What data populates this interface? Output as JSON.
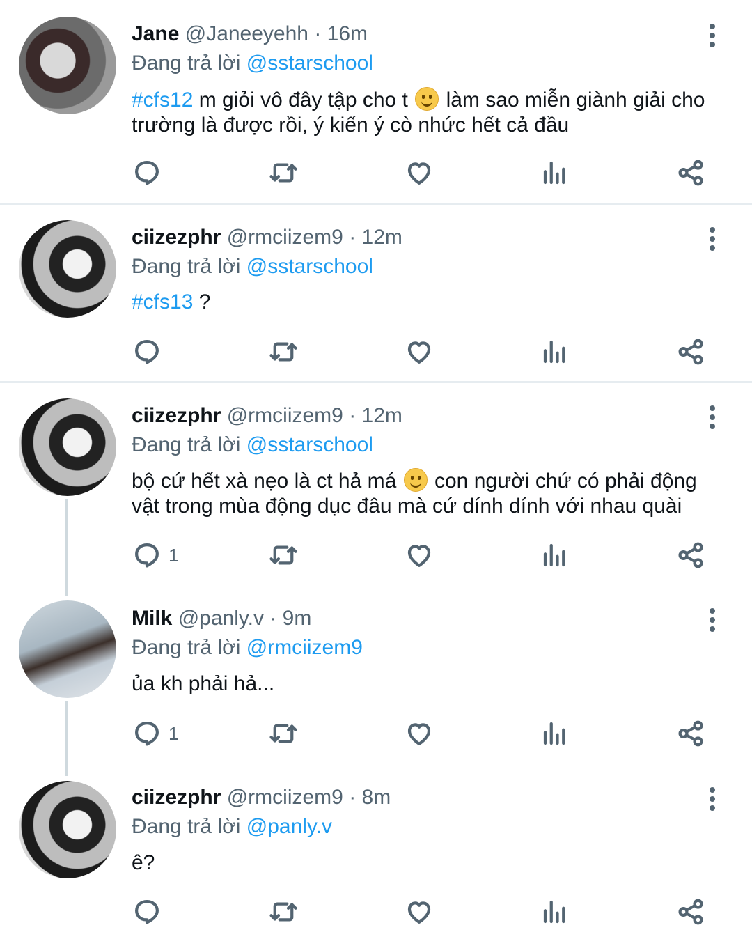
{
  "tweets": [
    {
      "name": "Jane",
      "handle": "@Janeeyehh",
      "time": "· 16m",
      "replying_prefix": "Đang trả lời",
      "replying_to": "@sstarschool",
      "hashtag": "#cfs12",
      "text_before_emoji": "m giỏi vô đây tập cho t",
      "emoji": "slight-smile-emoji",
      "text_after_emoji": "làm sao miễn giành giải cho trường là được rồi, ý kiến ý cò nhức hết cả đầu",
      "reply_count": ""
    },
    {
      "name": "ciizezphr",
      "handle": "@rmciizem9",
      "time": "· 12m",
      "replying_prefix": "Đang trả lời",
      "replying_to": "@sstarschool",
      "hashtag": "#cfs13",
      "text": "?",
      "reply_count": ""
    },
    {
      "name": "ciizezphr",
      "handle": "@rmciizem9",
      "time": "· 12m",
      "replying_prefix": "Đang trả lời",
      "replying_to": "@sstarschool",
      "text_before_emoji": "bộ cứ hết xà nẹo là ct hả má",
      "emoji": "grinning-emoji",
      "text_after_emoji": "con người chứ có phải động vật trong mùa động dục đâu mà cứ dính dính với nhau quài",
      "reply_count": "1"
    },
    {
      "name": "Milk",
      "handle": "@panly.v",
      "time": "· 9m",
      "replying_prefix": "Đang trả lời",
      "replying_to": "@rmciizem9",
      "text": "ủa kh phải hả...",
      "reply_count": "1"
    },
    {
      "name": "ciizezphr",
      "handle": "@rmciizem9",
      "time": "· 8m",
      "replying_prefix": "Đang trả lời",
      "replying_to": "@panly.v",
      "text": "ê?",
      "reply_count": ""
    }
  ],
  "icons": [
    "reply-icon",
    "retweet-icon",
    "like-icon",
    "analytics-icon",
    "share-icon",
    "more-options-icon"
  ],
  "colors": {
    "link": "#1d9bf0",
    "secondary": "#536471",
    "text": "#0f1419",
    "divider": "#e6ecf0"
  }
}
